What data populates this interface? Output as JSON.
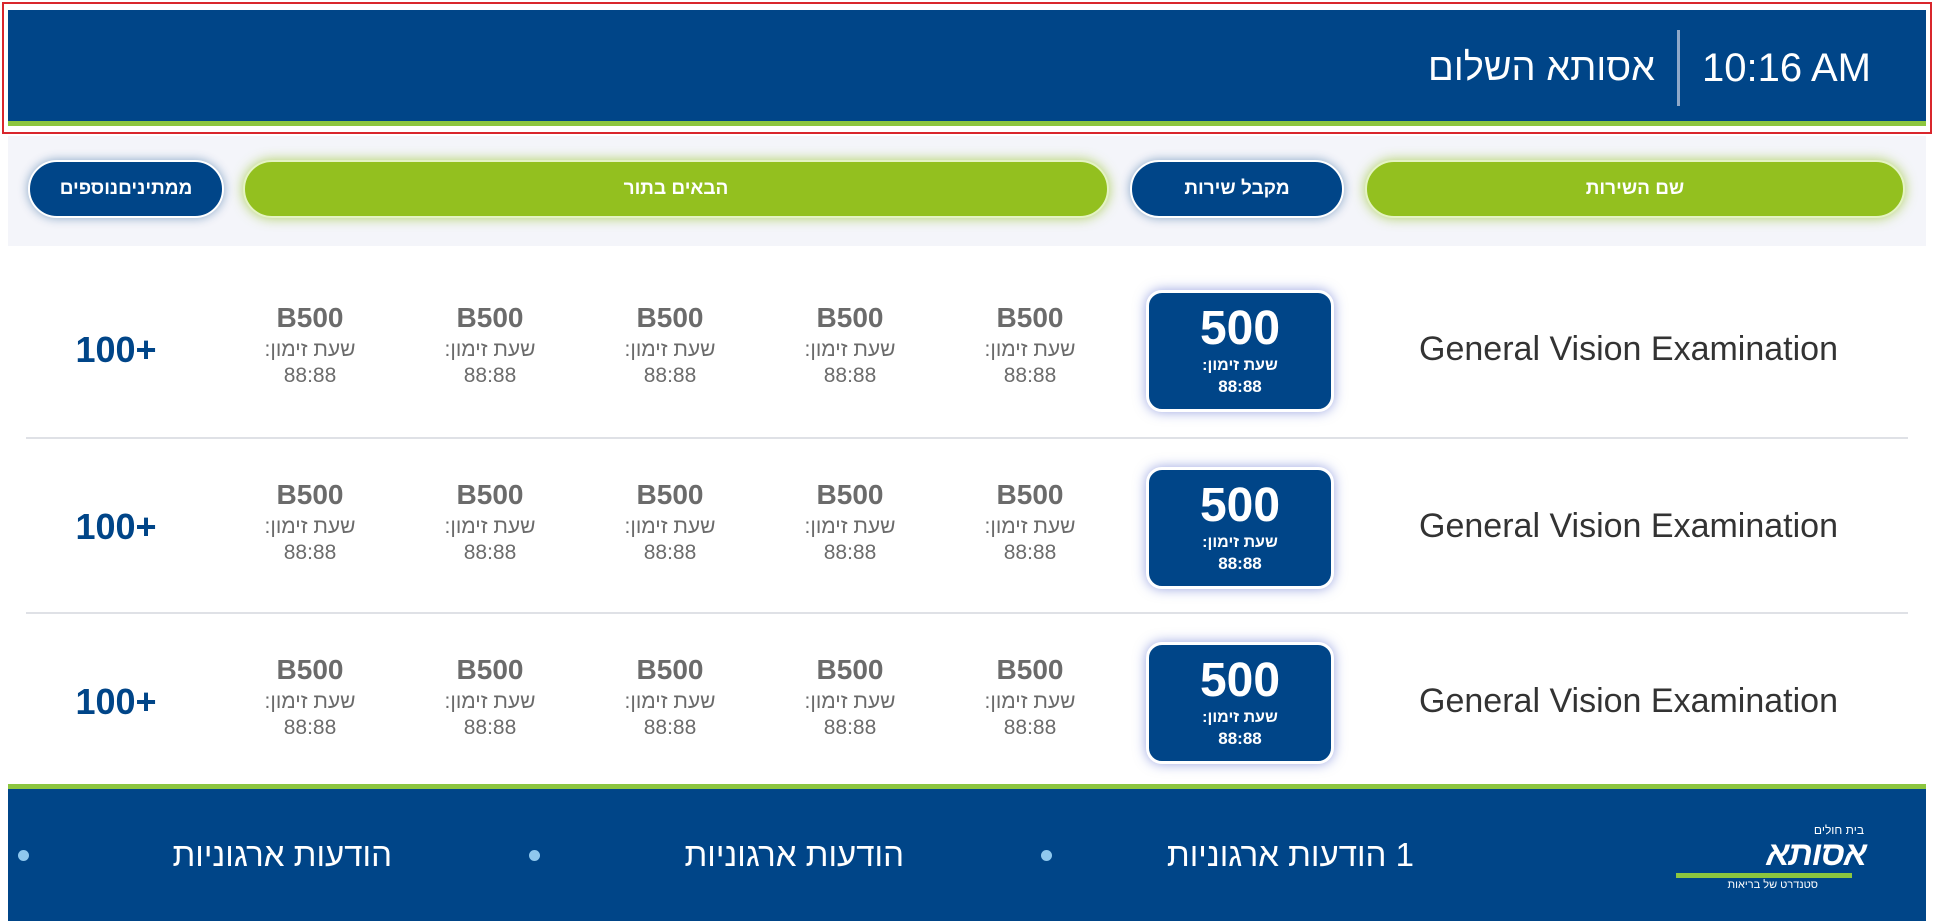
{
  "header": {
    "time": "10:16 AM",
    "hospital_name": "אסותא השלום"
  },
  "columns": {
    "service_name": "שם השירות",
    "receiving_service": "מקבל שירות",
    "next_in_line": "הבאים בתור",
    "more_waiting": "ממתיניםנוספים"
  },
  "rows": [
    {
      "service": "General Vision Examination",
      "current": {
        "number": "500",
        "label": "שעת זימון:",
        "time": "88:88"
      },
      "next": [
        {
          "number": "B500",
          "label": "שעת זימון:",
          "time": "88:88"
        },
        {
          "number": "B500",
          "label": "שעת זימון:",
          "time": "88:88"
        },
        {
          "number": "B500",
          "label": "שעת זימון:",
          "time": "88:88"
        },
        {
          "number": "B500",
          "label": "שעת זימון:",
          "time": "88:88"
        },
        {
          "number": "B500",
          "label": "שעת זימון:",
          "time": "88:88"
        }
      ],
      "waiting": "100+"
    },
    {
      "service": "General Vision Examination",
      "current": {
        "number": "500",
        "label": "שעת זימון:",
        "time": "88:88"
      },
      "next": [
        {
          "number": "B500",
          "label": "שעת זימון:",
          "time": "88:88"
        },
        {
          "number": "B500",
          "label": "שעת זימון:",
          "time": "88:88"
        },
        {
          "number": "B500",
          "label": "שעת זימון:",
          "time": "88:88"
        },
        {
          "number": "B500",
          "label": "שעת זימון:",
          "time": "88:88"
        },
        {
          "number": "B500",
          "label": "שעת זימון:",
          "time": "88:88"
        }
      ],
      "waiting": "100+"
    },
    {
      "service": "General Vision Examination",
      "current": {
        "number": "500",
        "label": "שעת זימון:",
        "time": "88:88"
      },
      "next": [
        {
          "number": "B500",
          "label": "שעת זימון:",
          "time": "88:88"
        },
        {
          "number": "B500",
          "label": "שעת זימון:",
          "time": "88:88"
        },
        {
          "number": "B500",
          "label": "שעת זימון:",
          "time": "88:88"
        },
        {
          "number": "B500",
          "label": "שעת זימון:",
          "time": "88:88"
        },
        {
          "number": "B500",
          "label": "שעת זימון:",
          "time": "88:88"
        }
      ],
      "waiting": "100+"
    }
  ],
  "footer": {
    "logo": {
      "tagline": "בית חולים",
      "wordmark": "אסותא",
      "subtitle": "סטנדרט של בריאות"
    },
    "ticker": [
      "1 הודעות ארגוניות",
      "הודעות ארגוניות",
      "הודעות ארגוניות"
    ]
  },
  "colors": {
    "primary_blue": "#004588",
    "accent_green": "#93c01f",
    "header_line_green": "#8cc63f",
    "highlight_frame": "#d9262c"
  }
}
